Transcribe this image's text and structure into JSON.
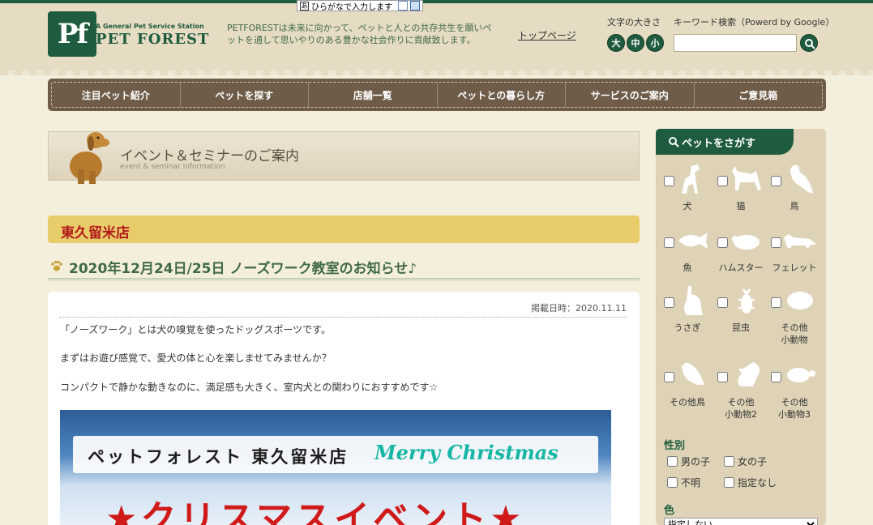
{
  "toolbar_ruby": {
    "box": "あ",
    "label": "ひらがなで入力します"
  },
  "header": {
    "logo_mark": "Pf",
    "logo_sub": "A General Pet Service Station",
    "logo_name": "PET FOREST",
    "tagline": "PETFORESTは未来に向かって、ペットと人との共存共生を願いペットを通して思いやりのある豊かな社会作りに貢献致します。",
    "top_link": "トップページ",
    "font_size_label": "文字の大きさ",
    "font_sizes": [
      "大",
      "中",
      "小"
    ],
    "search_label": "キーワード検索（Powerd by Google）",
    "search_value": ""
  },
  "nav": [
    "注目ペット紹介",
    "ペットを探す",
    "店舗一覧",
    "ペットとの暮らし方",
    "サービスのご案内",
    "ご意見箱"
  ],
  "banner": {
    "title": "イベント＆セミナーのご案内",
    "subtitle": "event & seminar information"
  },
  "store": "東久留米店",
  "post": {
    "title": "2020年12月24日/25日 ノーズワーク教室のお知らせ♪",
    "posted": "掲載日時：2020.11.11",
    "paragraphs": [
      "「ノーズワーク」とは犬の嗅覚を使ったドッグスポーツです。",
      "まずはお遊び感覚で、愛犬の体と心を楽しませてみませんか？",
      "コンパクトで静かな動きなのに、満足感も大きく、室内犬との関わりにおすすめです☆"
    ],
    "poster": {
      "store": "ペットフォレスト 東久留米店",
      "xmas": "Merry Christmas",
      "headline": "★クリスマスイベント★"
    }
  },
  "sidebar": {
    "title": "ペットをさがす",
    "pets": [
      {
        "name": "犬",
        "icon": "dog-icon"
      },
      {
        "name": "猫",
        "icon": "cat-icon"
      },
      {
        "name": "鳥",
        "icon": "bird-icon"
      },
      {
        "name": "魚",
        "icon": "fish-icon"
      },
      {
        "name": "ハムスター",
        "icon": "hamster-icon"
      },
      {
        "name": "フェレット",
        "icon": "ferret-icon"
      },
      {
        "name": "うさぎ",
        "icon": "rabbit-icon"
      },
      {
        "name": "昆虫",
        "icon": "beetle-icon"
      },
      {
        "name": "その他\n小動物",
        "icon": "small-animal-icon"
      },
      {
        "name": "その他鳥",
        "icon": "other-bird-icon"
      },
      {
        "name": "その他\n小動物2",
        "icon": "squirrel-icon"
      },
      {
        "name": "その他\n小動物3",
        "icon": "turtle-icon"
      }
    ],
    "gender_title": "性別",
    "genders": [
      "男の子",
      "女の子",
      "不明",
      "指定なし"
    ],
    "color_title": "色",
    "color_selected": "指定しない"
  },
  "colors": {
    "green": "#1f5b3e",
    "nav": "#6e5c48",
    "store_bar": "#e9cc6a",
    "store_text": "#b21a1a"
  }
}
